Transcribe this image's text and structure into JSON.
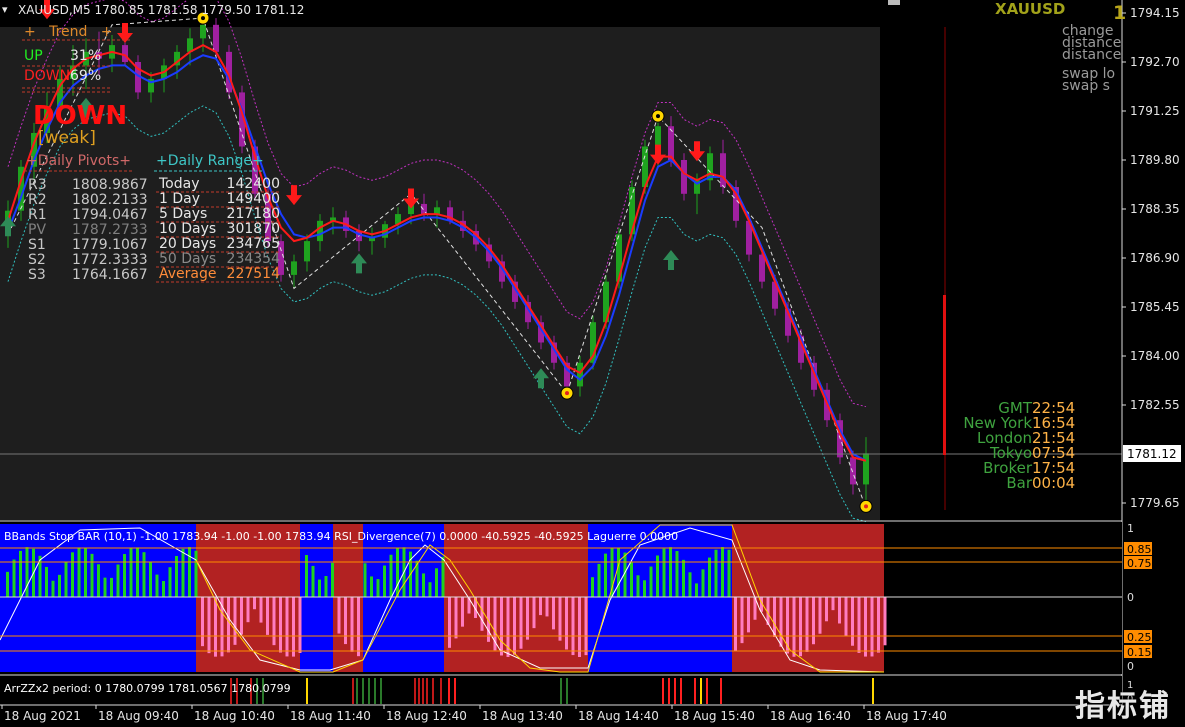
{
  "window": {
    "symbol_info": "XAUUSD,M5  1780.85 1781.58 1779.50 1781.12",
    "symbol_big": "XAUUSD",
    "top_right_digit": "1"
  },
  "trend_panel": {
    "title": "+   Trend   +",
    "up_label": "UP",
    "up_value": "31%",
    "down_label": "DOWN",
    "down_value": "69%",
    "signal": "DOWN",
    "strength": "[weak]"
  },
  "pivots": {
    "title": "+Daily Pivots+",
    "rows": [
      {
        "label": "R3",
        "value": "1808.9867",
        "color": "#c8c8c8"
      },
      {
        "label": "R2",
        "value": "1802.2133",
        "color": "#c8c8c8"
      },
      {
        "label": "R1",
        "value": "1794.0467",
        "color": "#c8c8c8"
      },
      {
        "label": "PV",
        "value": "1787.2733",
        "color": "#808080"
      },
      {
        "label": "S1",
        "value": "1779.1067",
        "color": "#c8c8c8"
      },
      {
        "label": "S2",
        "value": "1772.3333",
        "color": "#c8c8c8"
      },
      {
        "label": "S3",
        "value": "1764.1667",
        "color": "#c8c8c8"
      }
    ]
  },
  "ranges": {
    "title": "+Daily Range+",
    "rows": [
      {
        "label": "Today",
        "value": "142400",
        "color": "#e6e6e6"
      },
      {
        "label": "1 Day",
        "value": "149400",
        "color": "#e6e6e6"
      },
      {
        "label": "5 Days",
        "value": "217180",
        "color": "#e6e6e6"
      },
      {
        "label": "10 Days",
        "value": "301870",
        "color": "#e6e6e6"
      },
      {
        "label": "20 Days",
        "value": "234765",
        "color": "#e6e6e6"
      },
      {
        "label": "50 Days",
        "value": "234354",
        "color": "#8a8a8a"
      },
      {
        "label": "Average",
        "value": "227514",
        "color": "#ff8c3a"
      }
    ]
  },
  "info_top_right": [
    "change",
    "distance",
    "distance",
    "swap lo",
    "swap s"
  ],
  "clock": [
    {
      "label": "GMT",
      "value": "22:54"
    },
    {
      "label": "New York",
      "value": "16:54"
    },
    {
      "label": "London",
      "value": "21:54"
    },
    {
      "label": "Tokyo",
      "value": "07:54"
    },
    {
      "label": "Broker",
      "value": "17:54"
    },
    {
      "label": "Bar",
      "value": "00:04"
    }
  ],
  "price_axis": {
    "labels": [
      "1794.15",
      "1792.70",
      "1791.25",
      "1789.80",
      "1788.35",
      "1786.90",
      "1785.45",
      "1784.00",
      "1782.55",
      "1781.12",
      "1779.65"
    ],
    "current": "1781.12"
  },
  "time_axis": [
    "18 Aug 2021",
    "18 Aug 09:40",
    "18 Aug 10:40",
    "18 Aug 11:40",
    "18 Aug 12:40",
    "18 Aug 13:40",
    "18 Aug 14:40",
    "18 Aug 15:40",
    "18 Aug 16:40",
    "18 Aug 17:40"
  ],
  "indicator_panel": {
    "label": "BBands Stop BAR (10,1) -1.00 1783.94 -1.00 -1.00 1783.94  RSI_Divergence(7) 0.0000 -40.5925 -40.5925  Laguerre 0.0000",
    "levels": [
      "1",
      "0.85",
      "0.75",
      "0",
      "0.25",
      "0.15",
      "0"
    ]
  },
  "zz_panel": {
    "label": "ArrZZx2 period: 0 1780.0799 1781.0567 1780.0799",
    "levels": [
      "1",
      "0"
    ]
  },
  "watermark": "指标铺",
  "colors": {
    "bull": "#1fa31f",
    "bear": "#a020a0",
    "ma_red": "#ff1a1a",
    "ma_blue": "#1a3cff",
    "panel_blue": "#0000ff",
    "panel_red": "#b22222",
    "orange": "#ffb347",
    "green_text": "#3fa33f"
  },
  "chart_data": {
    "type": "candlestick",
    "ylim": [
      1779.3,
      1794.6
    ],
    "candles": [
      {
        "o": 1787.6,
        "h": 1788.6,
        "l": 1787.2,
        "c": 1788.3
      },
      {
        "o": 1788.3,
        "h": 1789.8,
        "l": 1788.0,
        "c": 1789.6
      },
      {
        "o": 1789.6,
        "h": 1790.9,
        "l": 1789.2,
        "c": 1790.6
      },
      {
        "o": 1790.6,
        "h": 1791.8,
        "l": 1790.3,
        "c": 1791.4
      },
      {
        "o": 1791.4,
        "h": 1792.6,
        "l": 1791.0,
        "c": 1792.2
      },
      {
        "o": 1792.2,
        "h": 1793.2,
        "l": 1791.7,
        "c": 1792.6
      },
      {
        "o": 1792.6,
        "h": 1793.4,
        "l": 1791.9,
        "c": 1793.0
      },
      {
        "o": 1793.0,
        "h": 1793.6,
        "l": 1792.3,
        "c": 1792.8
      },
      {
        "o": 1792.8,
        "h": 1793.5,
        "l": 1792.4,
        "c": 1793.2
      },
      {
        "o": 1793.2,
        "h": 1793.8,
        "l": 1792.6,
        "c": 1792.7
      },
      {
        "o": 1792.7,
        "h": 1792.9,
        "l": 1791.6,
        "c": 1791.8
      },
      {
        "o": 1791.8,
        "h": 1792.4,
        "l": 1791.5,
        "c": 1792.2
      },
      {
        "o": 1792.2,
        "h": 1792.8,
        "l": 1791.8,
        "c": 1792.6
      },
      {
        "o": 1792.6,
        "h": 1793.2,
        "l": 1792.2,
        "c": 1793.0
      },
      {
        "o": 1793.0,
        "h": 1793.7,
        "l": 1792.6,
        "c": 1793.4
      },
      {
        "o": 1793.4,
        "h": 1794.1,
        "l": 1793.0,
        "c": 1793.8
      },
      {
        "o": 1793.8,
        "h": 1794.0,
        "l": 1792.8,
        "c": 1793.0
      },
      {
        "o": 1793.0,
        "h": 1793.2,
        "l": 1791.6,
        "c": 1791.8
      },
      {
        "o": 1791.8,
        "h": 1792.0,
        "l": 1790.0,
        "c": 1790.2
      },
      {
        "o": 1790.2,
        "h": 1790.4,
        "l": 1788.6,
        "c": 1788.8
      },
      {
        "o": 1788.8,
        "h": 1789.0,
        "l": 1787.2,
        "c": 1787.4
      },
      {
        "o": 1787.4,
        "h": 1787.6,
        "l": 1786.2,
        "c": 1786.4
      },
      {
        "o": 1786.4,
        "h": 1787.0,
        "l": 1786.0,
        "c": 1786.8
      },
      {
        "o": 1786.8,
        "h": 1787.6,
        "l": 1786.5,
        "c": 1787.4
      },
      {
        "o": 1787.4,
        "h": 1788.2,
        "l": 1787.1,
        "c": 1788.0
      },
      {
        "o": 1788.0,
        "h": 1788.4,
        "l": 1787.6,
        "c": 1788.1
      },
      {
        "o": 1788.1,
        "h": 1788.3,
        "l": 1787.5,
        "c": 1787.7
      },
      {
        "o": 1787.7,
        "h": 1787.9,
        "l": 1787.1,
        "c": 1787.4
      },
      {
        "o": 1787.4,
        "h": 1787.8,
        "l": 1787.0,
        "c": 1787.5
      },
      {
        "o": 1787.5,
        "h": 1788.0,
        "l": 1787.2,
        "c": 1787.9
      },
      {
        "o": 1787.9,
        "h": 1788.4,
        "l": 1787.6,
        "c": 1788.2
      },
      {
        "o": 1788.2,
        "h": 1788.7,
        "l": 1787.9,
        "c": 1788.5
      },
      {
        "o": 1788.5,
        "h": 1788.8,
        "l": 1788.0,
        "c": 1788.2
      },
      {
        "o": 1788.2,
        "h": 1788.6,
        "l": 1787.8,
        "c": 1788.4
      },
      {
        "o": 1788.4,
        "h": 1788.6,
        "l": 1787.9,
        "c": 1788.0
      },
      {
        "o": 1788.0,
        "h": 1788.3,
        "l": 1787.5,
        "c": 1787.7
      },
      {
        "o": 1787.7,
        "h": 1787.9,
        "l": 1787.1,
        "c": 1787.3
      },
      {
        "o": 1787.3,
        "h": 1787.5,
        "l": 1786.6,
        "c": 1786.8
      },
      {
        "o": 1786.8,
        "h": 1787.0,
        "l": 1786.0,
        "c": 1786.2
      },
      {
        "o": 1786.2,
        "h": 1786.4,
        "l": 1785.4,
        "c": 1785.6
      },
      {
        "o": 1785.6,
        "h": 1785.8,
        "l": 1784.8,
        "c": 1785.0
      },
      {
        "o": 1785.0,
        "h": 1785.2,
        "l": 1784.2,
        "c": 1784.4
      },
      {
        "o": 1784.4,
        "h": 1784.6,
        "l": 1783.6,
        "c": 1783.8
      },
      {
        "o": 1783.8,
        "h": 1784.0,
        "l": 1782.9,
        "c": 1783.1
      },
      {
        "o": 1783.1,
        "h": 1784.0,
        "l": 1782.8,
        "c": 1783.8
      },
      {
        "o": 1783.8,
        "h": 1785.2,
        "l": 1783.6,
        "c": 1785.0
      },
      {
        "o": 1785.0,
        "h": 1786.4,
        "l": 1784.8,
        "c": 1786.2
      },
      {
        "o": 1786.2,
        "h": 1787.8,
        "l": 1786.0,
        "c": 1787.6
      },
      {
        "o": 1787.6,
        "h": 1789.2,
        "l": 1787.4,
        "c": 1789.0
      },
      {
        "o": 1789.0,
        "h": 1790.4,
        "l": 1788.8,
        "c": 1790.2
      },
      {
        "o": 1790.2,
        "h": 1791.0,
        "l": 1789.6,
        "c": 1790.8
      },
      {
        "o": 1790.8,
        "h": 1791.1,
        "l": 1789.6,
        "c": 1789.8
      },
      {
        "o": 1789.8,
        "h": 1790.0,
        "l": 1788.6,
        "c": 1788.8
      },
      {
        "o": 1788.8,
        "h": 1789.4,
        "l": 1788.2,
        "c": 1789.2
      },
      {
        "o": 1789.2,
        "h": 1790.2,
        "l": 1788.9,
        "c": 1790.0
      },
      {
        "o": 1790.0,
        "h": 1790.4,
        "l": 1788.8,
        "c": 1789.0
      },
      {
        "o": 1789.0,
        "h": 1789.2,
        "l": 1787.8,
        "c": 1788.0
      },
      {
        "o": 1788.0,
        "h": 1788.2,
        "l": 1786.8,
        "c": 1787.0
      },
      {
        "o": 1787.0,
        "h": 1787.2,
        "l": 1786.0,
        "c": 1786.2
      },
      {
        "o": 1786.2,
        "h": 1786.4,
        "l": 1785.2,
        "c": 1785.4
      },
      {
        "o": 1785.4,
        "h": 1785.6,
        "l": 1784.4,
        "c": 1784.6
      },
      {
        "o": 1784.6,
        "h": 1784.8,
        "l": 1783.6,
        "c": 1783.8
      },
      {
        "o": 1783.8,
        "h": 1784.0,
        "l": 1782.8,
        "c": 1783.0
      },
      {
        "o": 1783.0,
        "h": 1783.2,
        "l": 1781.9,
        "c": 1782.1
      },
      {
        "o": 1782.1,
        "h": 1782.3,
        "l": 1780.8,
        "c": 1781.0
      },
      {
        "o": 1781.0,
        "h": 1781.2,
        "l": 1779.9,
        "c": 1780.2
      },
      {
        "o": 1780.2,
        "h": 1781.6,
        "l": 1779.5,
        "c": 1781.12
      }
    ],
    "ma_red": [
      1788.0,
      1789.2,
      1790.3,
      1791.2,
      1792.0,
      1792.5,
      1792.8,
      1792.9,
      1793.0,
      1792.9,
      1792.5,
      1792.3,
      1792.4,
      1792.7,
      1793.0,
      1793.2,
      1793.0,
      1792.3,
      1791.2,
      1789.9,
      1788.7,
      1787.8,
      1787.4,
      1787.5,
      1787.8,
      1788.0,
      1787.9,
      1787.7,
      1787.6,
      1787.7,
      1787.9,
      1788.1,
      1788.2,
      1788.2,
      1788.1,
      1787.9,
      1787.6,
      1787.2,
      1786.7,
      1786.1,
      1785.5,
      1784.9,
      1784.3,
      1783.7,
      1783.5,
      1784.0,
      1785.0,
      1786.3,
      1787.7,
      1789.0,
      1789.9,
      1789.9,
      1789.4,
      1789.2,
      1789.4,
      1789.3,
      1788.8,
      1788.0,
      1787.1,
      1786.2,
      1785.3,
      1784.4,
      1783.5,
      1782.6,
      1781.7,
      1781.0,
      1780.9
    ],
    "ma_blue": [
      1787.7,
      1788.7,
      1789.8,
      1790.7,
      1791.5,
      1792.0,
      1792.3,
      1792.5,
      1792.6,
      1792.6,
      1792.3,
      1792.1,
      1792.2,
      1792.4,
      1792.7,
      1792.9,
      1792.8,
      1792.2,
      1791.3,
      1790.2,
      1789.1,
      1788.2,
      1787.6,
      1787.5,
      1787.6,
      1787.8,
      1787.8,
      1787.6,
      1787.5,
      1787.6,
      1787.8,
      1788.0,
      1788.1,
      1788.1,
      1788.0,
      1787.8,
      1787.5,
      1787.1,
      1786.6,
      1786.0,
      1785.4,
      1784.8,
      1784.2,
      1783.6,
      1783.3,
      1783.7,
      1784.6,
      1785.8,
      1787.2,
      1788.6,
      1789.6,
      1789.8,
      1789.4,
      1789.1,
      1789.3,
      1789.3,
      1788.9,
      1788.1,
      1787.2,
      1786.3,
      1785.4,
      1784.5,
      1783.6,
      1782.7,
      1781.8,
      1781.1,
      1780.9
    ],
    "zigzag": [
      [
        0,
        1787.6
      ],
      [
        8,
        1793.8
      ],
      [
        15,
        1794.0
      ],
      [
        22,
        1786.0
      ],
      [
        31,
        1788.8
      ],
      [
        43,
        1782.9
      ],
      [
        50,
        1791.1
      ],
      [
        58,
        1787.8
      ],
      [
        66,
        1779.5
      ]
    ],
    "down_arrows_at": [
      [
        3,
        1794.2
      ],
      [
        9,
        1793.5
      ],
      [
        22,
        1788.7
      ],
      [
        31,
        1788.6
      ],
      [
        50,
        1789.9
      ],
      [
        53,
        1790.0
      ]
    ],
    "up_arrows_at": [
      [
        0,
        1787.9
      ],
      [
        6,
        1791.4
      ],
      [
        27,
        1786.8
      ],
      [
        41,
        1783.4
      ],
      [
        51,
        1786.9
      ]
    ]
  }
}
